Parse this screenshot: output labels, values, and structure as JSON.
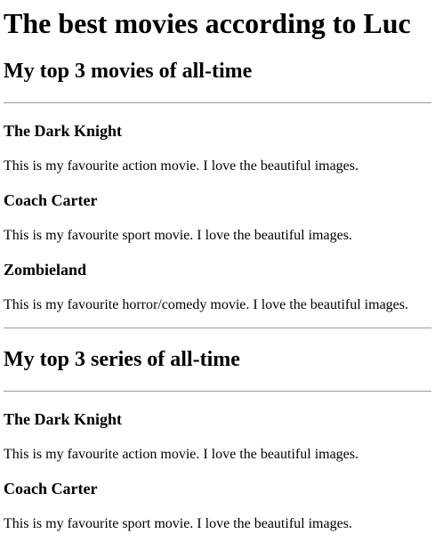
{
  "page": {
    "title": "The best movies according to Luc"
  },
  "sections": [
    {
      "heading": "My top 3 movies of all-time",
      "items": [
        {
          "title": "The Dark Knight",
          "description": "This is my favourite action movie. I love the beautiful images."
        },
        {
          "title": "Coach Carter",
          "description": "This is my favourite sport movie. I love the beautiful images."
        },
        {
          "title": "Zombieland",
          "description": "This is my favourite horror/comedy movie. I love the beautiful images."
        }
      ]
    },
    {
      "heading": "My top 3 series of all-time",
      "items": [
        {
          "title": "The Dark Knight",
          "description": "This is my favourite action movie. I love the beautiful images."
        },
        {
          "title": "Coach Carter",
          "description": "This is my favourite sport movie. I love the beautiful images."
        }
      ]
    }
  ]
}
